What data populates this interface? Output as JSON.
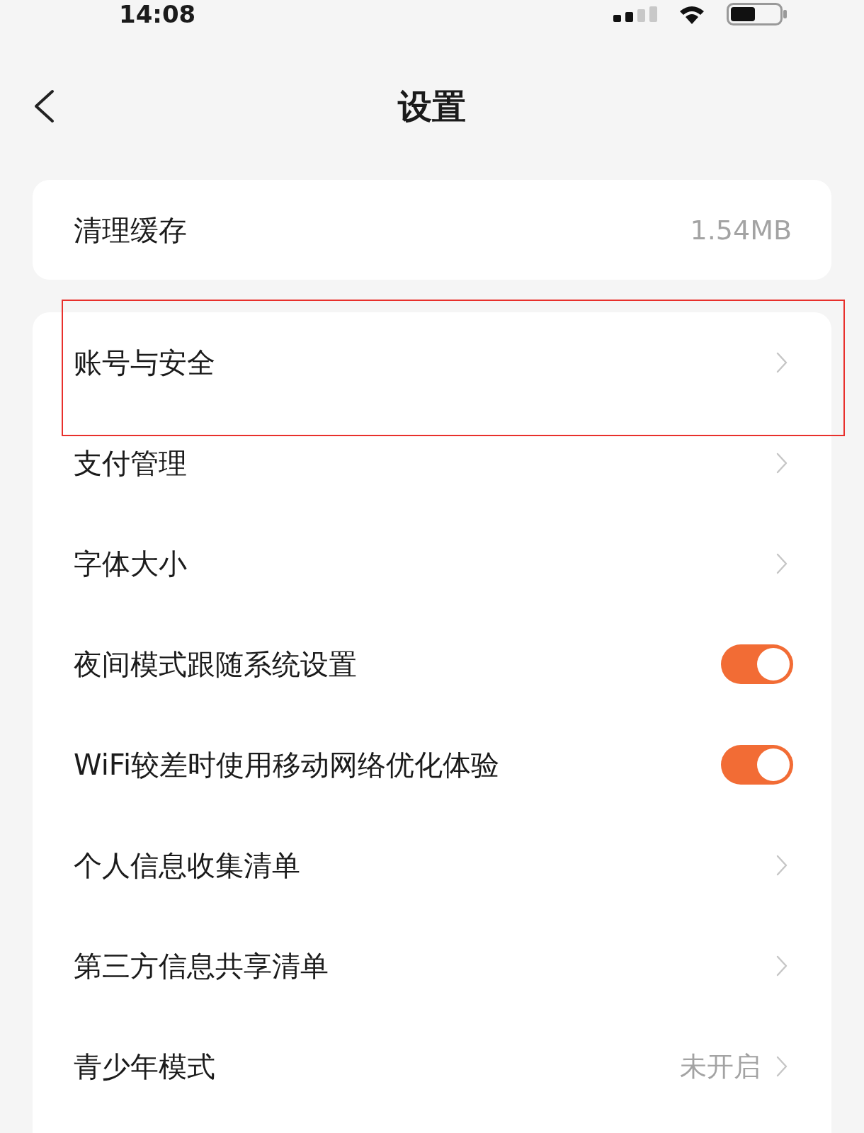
{
  "status_bar": {
    "time": "14:08"
  },
  "header": {
    "title": "设置"
  },
  "groups": [
    {
      "rows": [
        {
          "kind": "value",
          "label": "清理缓存",
          "value": "1.54MB",
          "highlighted": false
        }
      ]
    },
    {
      "rows": [
        {
          "kind": "link",
          "label": "账号与安全",
          "highlighted": true
        },
        {
          "kind": "link",
          "label": "支付管理",
          "highlighted": false
        },
        {
          "kind": "link",
          "label": "字体大小",
          "highlighted": false
        },
        {
          "kind": "toggle",
          "label": "夜间模式跟随系统设置",
          "on": true,
          "highlighted": false
        },
        {
          "kind": "toggle",
          "label": "WiFi较差时使用移动网络优化体验",
          "on": true,
          "highlighted": false
        },
        {
          "kind": "link",
          "label": "个人信息收集清单",
          "highlighted": false
        },
        {
          "kind": "link",
          "label": "第三方信息共享清单",
          "highlighted": false
        },
        {
          "kind": "link",
          "label": "青少年模式",
          "value": "未开启",
          "highlighted": false
        }
      ]
    }
  ]
}
